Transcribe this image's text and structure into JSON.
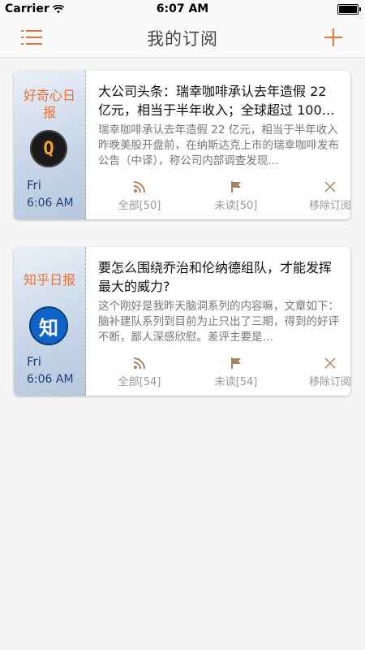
{
  "status_bar": {
    "carrier": "Carrier",
    "time": "6:07 AM",
    "battery_level": 0.9
  },
  "nav": {
    "title": "我的订阅",
    "menu_icon": "list-menu-icon",
    "add_icon": "plus-icon",
    "accent_color": "#e8733b"
  },
  "subscriptions": [
    {
      "name": "好奇心日报",
      "logo_letter": "Q",
      "day": "Fri",
      "time": "6:06 AM",
      "title": "大公司头条：瑞幸咖啡承认去年造假 22 亿元，相当于半年收入；全球超过 100…",
      "summary": "瑞幸咖啡承认去年造假 22 亿元，相当于半年收入 昨晚美股开盘前，在纳斯达克上市的瑞幸咖啡发布公告（中译），称公司内部调查发现…",
      "all_label": "全部[50]",
      "unread_label": "未读[50]",
      "remove_label": "移除订阅"
    },
    {
      "name": "知乎日报",
      "logo_letter": "知",
      "day": "Fri",
      "time": "6:06 AM",
      "title": "要怎么围绕乔治和伦纳德组队，才能发挥最大的威力?",
      "summary": "这个刚好是我昨天脑洞系列的内容嘛，文章如下： 脑补建队系列到目前为止只出了三期，得到的好评不断，鄙人深感欣慰。差评主要是…",
      "all_label": "全部[54]",
      "unread_label": "未读[54]",
      "remove_label": "移除订阅"
    }
  ]
}
